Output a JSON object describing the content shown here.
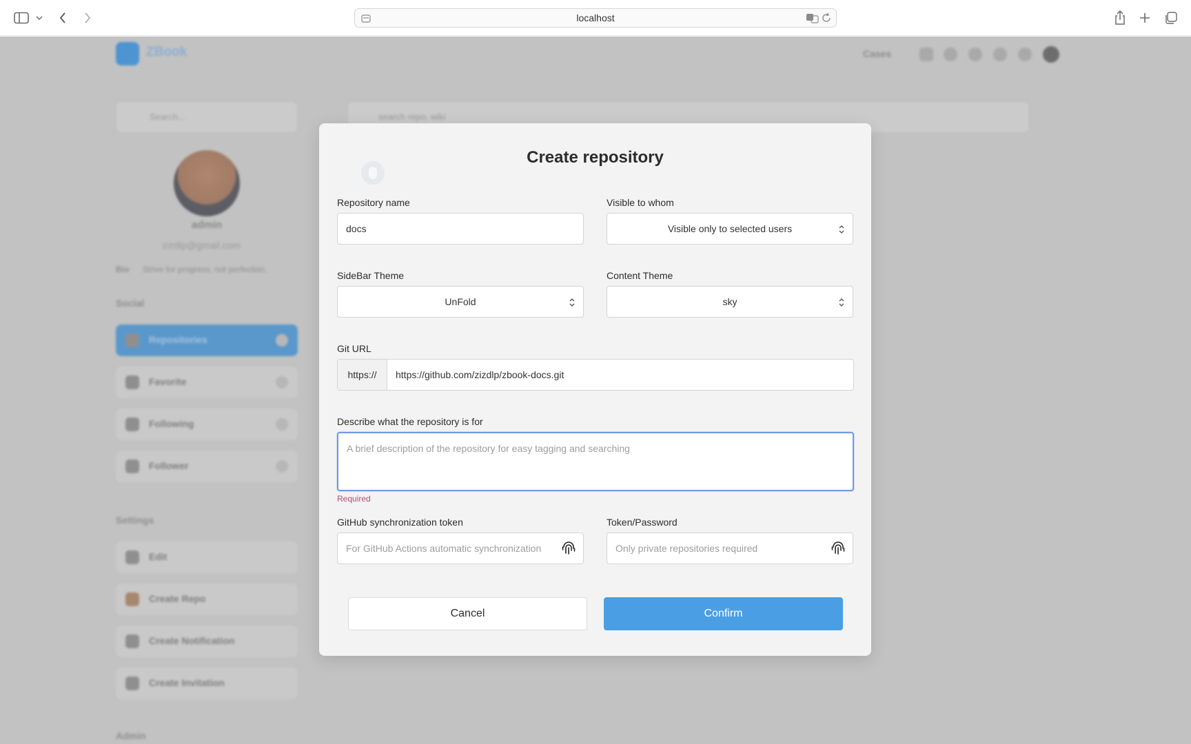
{
  "browser": {
    "url": "localhost"
  },
  "background": {
    "brand": "ZBook",
    "header_link": "Cases",
    "side_search_placeholder": "Search...",
    "main_search_placeholder": "search repo, wiki",
    "profile": {
      "name": "admin",
      "email": "zizdlp@gmail.com",
      "bio_label": "Bio",
      "bio": "Strive for progress, not perfection."
    },
    "social_heading": "Social",
    "social_items": [
      {
        "label": "Repositories"
      },
      {
        "label": "Favorite"
      },
      {
        "label": "Following"
      },
      {
        "label": "Follower"
      }
    ],
    "settings_heading": "Settings",
    "settings_items": [
      {
        "label": "Edit"
      },
      {
        "label": "Create Repo"
      },
      {
        "label": "Create Notification"
      },
      {
        "label": "Create Invitation"
      }
    ],
    "admin_heading": "Admin"
  },
  "modal": {
    "title": "Create repository",
    "repo_name": {
      "label": "Repository name",
      "value": "docs"
    },
    "visibility": {
      "label": "Visible to whom",
      "value": "Visible only to selected users"
    },
    "sidebar_theme": {
      "label": "SideBar Theme",
      "value": "UnFold"
    },
    "content_theme": {
      "label": "Content Theme",
      "value": "sky"
    },
    "git_url": {
      "label": "Git URL",
      "prefix": "https://",
      "value": "https://github.com/zizdlp/zbook-docs.git"
    },
    "description": {
      "label": "Describe what the repository is for",
      "placeholder": "A brief description of the repository for easy tagging and searching",
      "value": "",
      "error": "Required"
    },
    "sync_token": {
      "label": "GitHub synchronization token",
      "placeholder": "For GitHub Actions automatic synchronization"
    },
    "token_password": {
      "label": "Token/Password",
      "placeholder": "Only private repositories required"
    },
    "cancel_label": "Cancel",
    "confirm_label": "Confirm"
  },
  "colors": {
    "accent": "#4a9fe4",
    "focus_border": "#6f9ce0",
    "error": "#b24d74",
    "overlay": "#c2c2c2"
  }
}
